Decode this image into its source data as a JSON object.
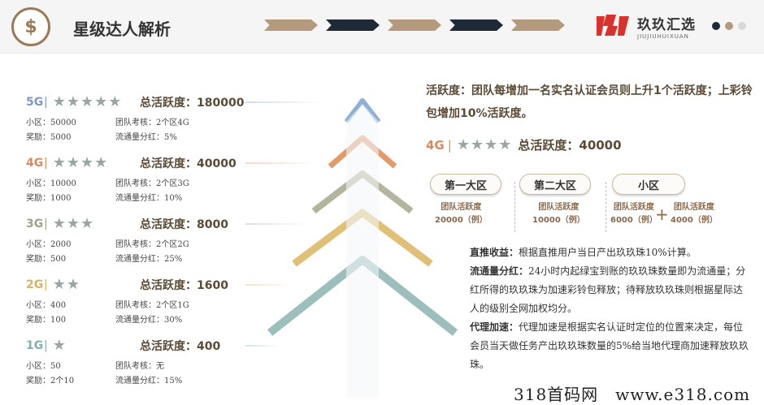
{
  "header": {
    "logo_glyph": "$",
    "title": "星级达人解析",
    "chevron_colors": [
      "#b39a7c",
      "#1f2a38",
      "#b39a7c",
      "#1f2a38",
      "#b39a7c"
    ],
    "brand_cn": "玖玖汇选",
    "brand_en": "JIUJIUHUIXUAN",
    "dot_colors": [
      "#1f2a38",
      "#b39a7c",
      "#d9d9d9"
    ]
  },
  "levels": [
    {
      "tag": "5G",
      "sep": "|",
      "stars": 5,
      "total": "总活跃度：180000",
      "color": "#7a9bc4",
      "star_color": "#9aa6a0",
      "r1a": "小区：50000",
      "r1b": "团队考核：2个区4G",
      "r2a": "奖励：5000",
      "r2b": "流通量分红：5%"
    },
    {
      "tag": "4G",
      "sep": "|",
      "stars": 4,
      "total": "总活跃度：40000",
      "color": "#d98a5c",
      "star_color": "#9aa6a0",
      "r1a": "小区：10000",
      "r1b": "团队考核：2个区3G",
      "r2a": "奖励：1000",
      "r2b": "流通量分红：10%"
    },
    {
      "tag": "3G",
      "sep": "|",
      "stars": 3,
      "total": "总活跃度：8000",
      "color": "#a3a08a",
      "star_color": "#9aa6a0",
      "r1a": "小区：2000",
      "r1b": "团队考核：2个区2G",
      "r2a": "奖励：500",
      "r2b": "流通量分红：25%"
    },
    {
      "tag": "2G",
      "sep": "|",
      "stars": 2,
      "total": "总活跃度：1600",
      "color": "#d8b25c",
      "star_color": "#9aa6a0",
      "r1a": "小区：400",
      "r1b": "团队考核：2个区1G",
      "r2a": "奖励：100",
      "r2b": "流通量分红：30%"
    },
    {
      "tag": "1G",
      "sep": "|",
      "stars": 1,
      "total": "总活跃度：400",
      "color": "#7fb0b0",
      "star_color": "#9aa6a0",
      "r1a": "小区：50",
      "r1b": "团队考核：无",
      "r2a": "奖励：2个10",
      "r2b": "流通量分红：15%"
    }
  ],
  "right": {
    "intro": "活跃度：团队每增加一名实名认证会员则上升1个活跃度；上彩铃包增加10%活跃度。",
    "example_tag": "4G",
    "example_sep": "|",
    "example_total": "总活跃度：40000",
    "zones": [
      {
        "label": "第一大区",
        "line1": "团队活跃度",
        "line2": "20000（例）"
      },
      {
        "label": "第二大区",
        "line1": "团队活跃度",
        "line2": "10000（例）"
      },
      {
        "label": "小区",
        "line1": "团队活跃度",
        "line2": "6000（例）",
        "line3": "团队活跃度",
        "line4": "4000（例）"
      }
    ],
    "plus": "+",
    "p1_title": "直推收益：",
    "p1_text": "根据直推用户当日产出玖玖珠10%计算。",
    "p2_title": "流通量分红：",
    "p2_text": "24小时内起绿宝到账的玖玖珠数量即为流通量；分红所得的玖玖珠为加速彩铃包释放；待释放玖玖珠则根据星际达人的级别全网加权均分。",
    "p3_title": "代理加速：",
    "p3_text": "代理加速是根据实名认证时定位的位置来决定，每位会员当天做任务产出玖玖珠数量的5%给当地代理商加速释放玖玖珠。"
  },
  "footer": "318首码网　www.e318.com"
}
